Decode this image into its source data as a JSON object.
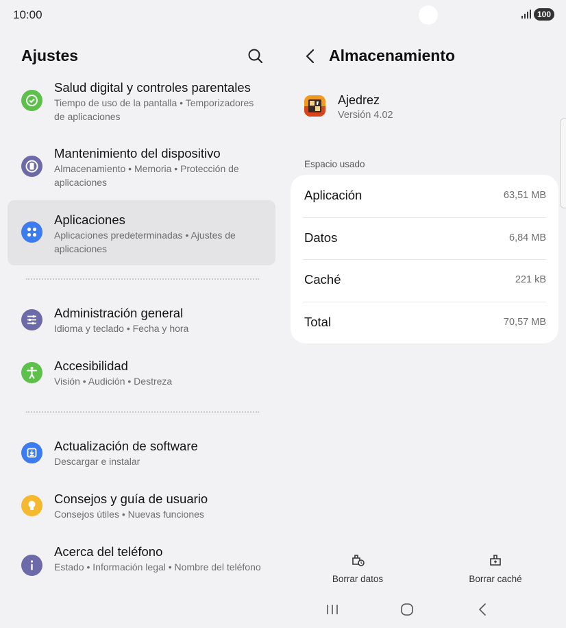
{
  "status_bar": {
    "time": "10:00",
    "battery": "100"
  },
  "left": {
    "title": "Ajustes",
    "items": [
      {
        "title": "Salud digital y controles parentales",
        "subtitle": "Tiempo de uso de la pantalla  •  Temporizadores de aplicaciones",
        "icon": "digital-wellbeing-icon",
        "color": "#5cc04a"
      },
      {
        "title": "Mantenimiento del dispositivo",
        "subtitle": "Almacenamiento  •  Memoria  •  Protección de aplicaciones",
        "icon": "device-care-icon",
        "color": "#6c6aa8"
      },
      {
        "title": "Aplicaciones",
        "subtitle": "Aplicaciones predeterminadas  •  Ajustes de aplicaciones",
        "icon": "apps-icon",
        "color": "#3b7cf0"
      },
      {
        "title": "Administración general",
        "subtitle": "Idioma y teclado  •  Fecha y hora",
        "icon": "sliders-icon",
        "color": "#6c6aa8"
      },
      {
        "title": "Accesibilidad",
        "subtitle": "Visión  •  Audición  •  Destreza",
        "icon": "accessibility-icon",
        "color": "#5cc04a"
      },
      {
        "title": "Actualización de software",
        "subtitle": "Descargar e instalar",
        "icon": "software-update-icon",
        "color": "#3b7cf0"
      },
      {
        "title": "Consejos y guía de usuario",
        "subtitle": "Consejos útiles  •  Nuevas funciones",
        "icon": "bulb-icon",
        "color": "#f5b82e"
      },
      {
        "title": "Acerca del teléfono",
        "subtitle": "Estado  •  Información legal  •  Nombre del teléfono",
        "icon": "info-icon",
        "color": "#6c6aa8"
      }
    ]
  },
  "right": {
    "title": "Almacenamiento",
    "app": {
      "name": "Ajedrez",
      "version": "Versión 4.02"
    },
    "section_label": "Espacio usado",
    "rows": [
      {
        "label": "Aplicación",
        "value": "63,51 MB"
      },
      {
        "label": "Datos",
        "value": "6,84 MB"
      },
      {
        "label": "Caché",
        "value": "221 kB"
      },
      {
        "label": "Total",
        "value": "70,57 MB"
      }
    ],
    "actions": {
      "clear_data": "Borrar datos",
      "clear_cache": "Borrar caché"
    }
  }
}
